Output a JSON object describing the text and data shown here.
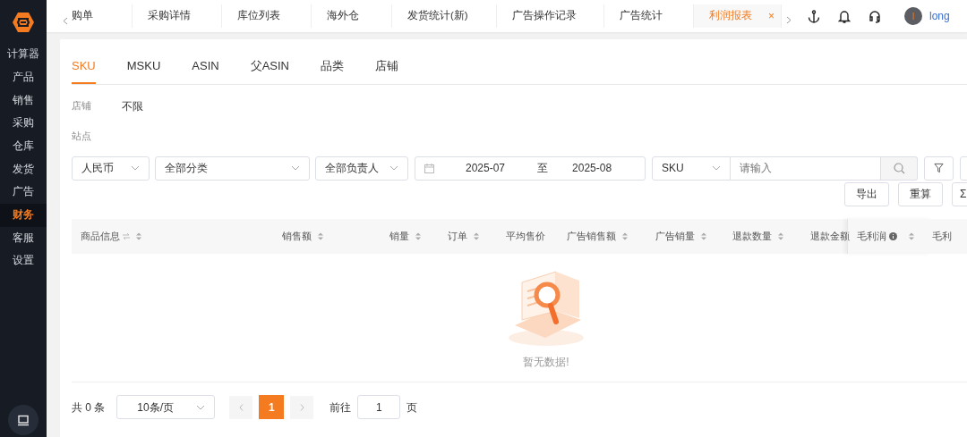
{
  "sidebar": {
    "items": [
      {
        "label": "计算器",
        "selected": false
      },
      {
        "label": "产品",
        "selected": false
      },
      {
        "label": "销售",
        "selected": false
      },
      {
        "label": "采购",
        "selected": false
      },
      {
        "label": "仓库",
        "selected": false
      },
      {
        "label": "发货",
        "selected": false
      },
      {
        "label": "广告",
        "selected": false
      },
      {
        "label": "财务",
        "selected": true
      },
      {
        "label": "客服",
        "selected": false
      },
      {
        "label": "设置",
        "selected": false
      }
    ]
  },
  "tabbar": {
    "tabs": [
      {
        "label": "购单",
        "selected": false
      },
      {
        "label": "采购详情",
        "selected": false
      },
      {
        "label": "库位列表",
        "selected": false
      },
      {
        "label": "海外仓",
        "selected": false
      },
      {
        "label": "发货统计(新)",
        "selected": false
      },
      {
        "label": "广告操作记录",
        "selected": false
      },
      {
        "label": "广告统计",
        "selected": false
      },
      {
        "label": "利润报表",
        "selected": true,
        "close_label": "×"
      }
    ]
  },
  "user": {
    "avatar_letter": "l",
    "name": "long"
  },
  "subtabs": [
    {
      "label": "SKU",
      "selected": true
    },
    {
      "label": "MSKU",
      "selected": false
    },
    {
      "label": "ASIN",
      "selected": false
    },
    {
      "label": "父ASIN",
      "selected": false
    },
    {
      "label": "品类",
      "selected": false
    },
    {
      "label": "店铺",
      "selected": false
    }
  ],
  "filters": [
    {
      "label": "店铺",
      "value": "不限"
    },
    {
      "label": "站点"
    }
  ],
  "toolbar": {
    "currency": "人民币",
    "category": "全部分类",
    "owner": "全部负责人",
    "date_range": {
      "start": "2025-07",
      "separator": "至",
      "end": "2025-08"
    },
    "search": {
      "field": "SKU",
      "placeholder": "请输入"
    }
  },
  "actions": [
    {
      "label": "导出"
    },
    {
      "label": "重算"
    },
    {
      "label": "Σ"
    }
  ],
  "table": {
    "columns": [
      {
        "label": "商品信息",
        "sortable": true,
        "info": false
      },
      {
        "label": "销售额",
        "sortable": true,
        "info": false
      },
      {
        "label": "销量",
        "sortable": true,
        "info": false
      },
      {
        "label": "订单",
        "sortable": true,
        "info": false
      },
      {
        "label": "平均售价",
        "sortable": false,
        "info": false
      },
      {
        "label": "广告销售额",
        "sortable": true,
        "info": false
      },
      {
        "label": "广告销量",
        "sortable": true,
        "info": false
      },
      {
        "label": "退款数量",
        "sortable": true,
        "info": false
      },
      {
        "label": "退款金额"
      },
      {
        "label": "毛利润",
        "sortable": true,
        "info": true
      },
      {
        "label": "毛利",
        "sortable": false,
        "info": false
      }
    ],
    "empty_text": "暂无数据!"
  },
  "pagination": {
    "total": "共 0 条",
    "page_size": "10条/页",
    "pages": [
      {
        "label": "1",
        "selected": true
      }
    ],
    "goto_label": "前往",
    "goto_value": "1",
    "page_suffix": "页"
  }
}
